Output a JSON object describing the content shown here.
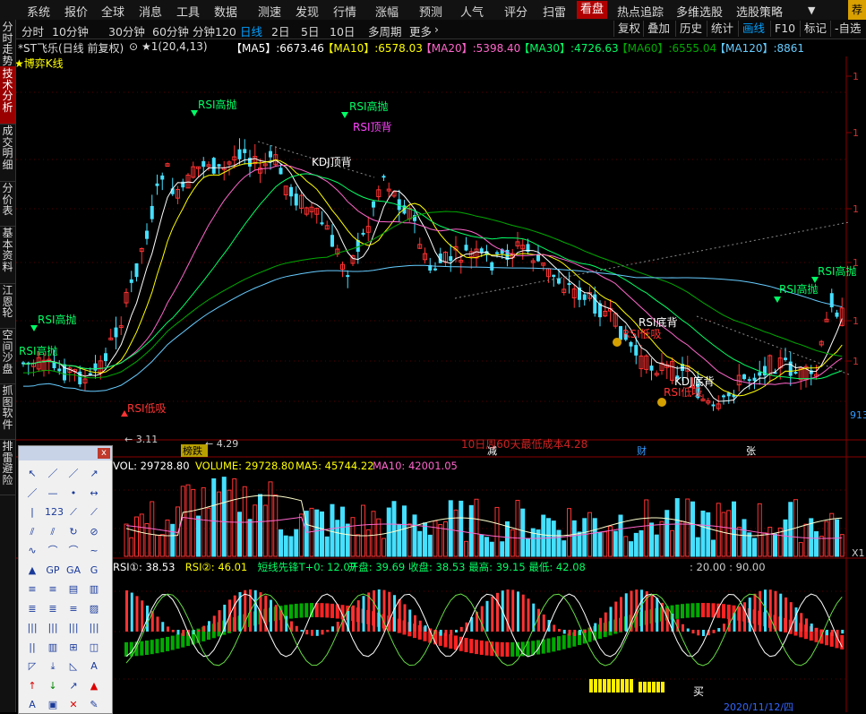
{
  "menu": {
    "items": [
      "系统",
      "报价",
      "全球",
      "消息",
      "工具",
      "数据",
      "测速",
      "发现",
      "行情",
      "涨幅",
      "预测",
      "人气",
      "评分",
      "扫雷",
      "看盘",
      "热点追踪",
      "多维选股",
      "选股策略"
    ],
    "active": "看盘",
    "dropdown_glyph": "▼",
    "corner": "荐"
  },
  "periods": {
    "items": [
      "分时",
      "10分钟",
      "30分钟",
      "60分钟",
      "分钟120",
      "日线",
      "2日",
      "5日",
      "10日",
      "多周期",
      "更多"
    ],
    "active": "日线",
    "more_glyph": "›"
  },
  "right_buttons": [
    "复权",
    "叠加",
    "历史",
    "统计",
    "画线",
    "F10",
    "标记",
    "-自选"
  ],
  "left_tabs": [
    "分时走势",
    "技术分析",
    "成交明细",
    "分价表",
    "基本资料",
    "江恩轮",
    "空间沙盘",
    "抓图软件",
    "排雷避险"
  ],
  "left_active": "技术分析",
  "stock": {
    "name": "*ST飞乐(日线 前复权)",
    "params": "★1(20,4,13)"
  },
  "ma": [
    {
      "label": "【MA5】:",
      "value": "6673.46",
      "color": "#ffffff"
    },
    {
      "label": "【MA10】:",
      "value": "6578.03",
      "color": "#ffff00"
    },
    {
      "label": "【MA20】:",
      "value": "5398.40",
      "color": "#ff66cc"
    },
    {
      "label": "【MA30】:",
      "value": "4726.63",
      "color": "#00ff66"
    },
    {
      "label": "【MA60】:",
      "value": "6555.04",
      "color": "#00aa00"
    },
    {
      "label": "【MA120】:",
      "value": "8861",
      "color": "#66ccff"
    }
  ],
  "indicator_title": "★博弈K线",
  "annotations": {
    "rsi_high_1": "RSI高抛",
    "rsi_high_2": "RSI高抛",
    "rsi_high_3": "RSI高抛",
    "rsi_high_4": "RSI高抛",
    "rsi_high_5": "RSI高抛",
    "rsi_top_div": "RSI顶背",
    "kdj_top_div": "KDJ顶背",
    "rsi_low_1": "RSI低吸",
    "rsi_low_2": "RSI低吸",
    "rsi_low_3": "RSI低吸",
    "rsi_bot_div": "RSI底背",
    "kdj_bot_div": "KDJ底背",
    "low_price": "3.11",
    "low_price_2": "4.29",
    "side_price": "913",
    "news_line": "10日周60天最低成本4.28",
    "tag_bang": "榜跌",
    "tag_jian": "减",
    "tag_cai": "财",
    "tag_zhang": "张"
  },
  "volume": {
    "vol": "VOL: 29728.80",
    "volume": "VOLUME: 29728.80",
    "ma5": "MA5: 45744.22",
    "ma10": "MA10: 42001.05",
    "axis_label": "X1"
  },
  "rsi": {
    "rsi1": "RSI①: 38.53",
    "rsi2": "RSI②: 46.01",
    "t0": "短线先锋T+0: 12.07",
    "open": "开盘: 39.69",
    "close": "收盘: 38.53",
    "high": "最高: 39.15",
    "low": "最低: 42.08",
    "levels": ": 20.00 : 90.00",
    "buy": "买"
  },
  "bottom_date": "2020/11/12/四",
  "colors": {
    "up": "#ff3333",
    "down": "#44e0ff",
    "ma5": "#ffffff",
    "ma10": "#ffff00",
    "ma20": "#ff66cc",
    "ma30": "#00ff66",
    "ma60": "#00aa00",
    "ma120": "#66ccff"
  }
}
